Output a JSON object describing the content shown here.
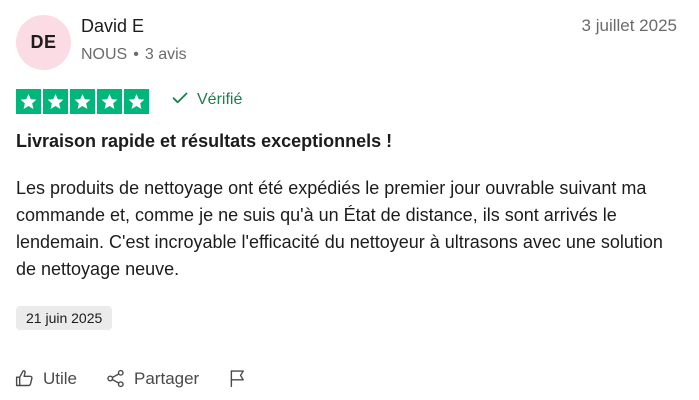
{
  "reviewer": {
    "initials": "DE",
    "name": "David E",
    "country": "NOUS",
    "review_count": "3 avis",
    "separator": "•"
  },
  "review": {
    "date": "3 juillet 2025",
    "rating": 5,
    "max_rating": 5,
    "verified_label": "Vérifié",
    "title": "Livraison rapide et résultats exceptionnels !",
    "body": "Les produits de nettoyage ont été expédiés le premier jour ouvrable suivant ma commande et, comme je ne suis qu'à un État de distance, ils sont arrivés le lendemain. C'est incroyable l'efficacité du nettoyeur à ultrasons avec une solution de nettoyage neuve.",
    "experience_date": "21 juin 2025"
  },
  "actions": {
    "useful_label": "Utile",
    "share_label": "Partager"
  },
  "colors": {
    "star_green": "#00b67a",
    "verified_green": "#1a7f4b",
    "avatar_bg": "#fbdce4"
  },
  "icons": {
    "star": "star-icon",
    "verified": "check-icon",
    "useful": "thumbs-up-icon",
    "share": "share-icon",
    "report": "flag-icon"
  }
}
